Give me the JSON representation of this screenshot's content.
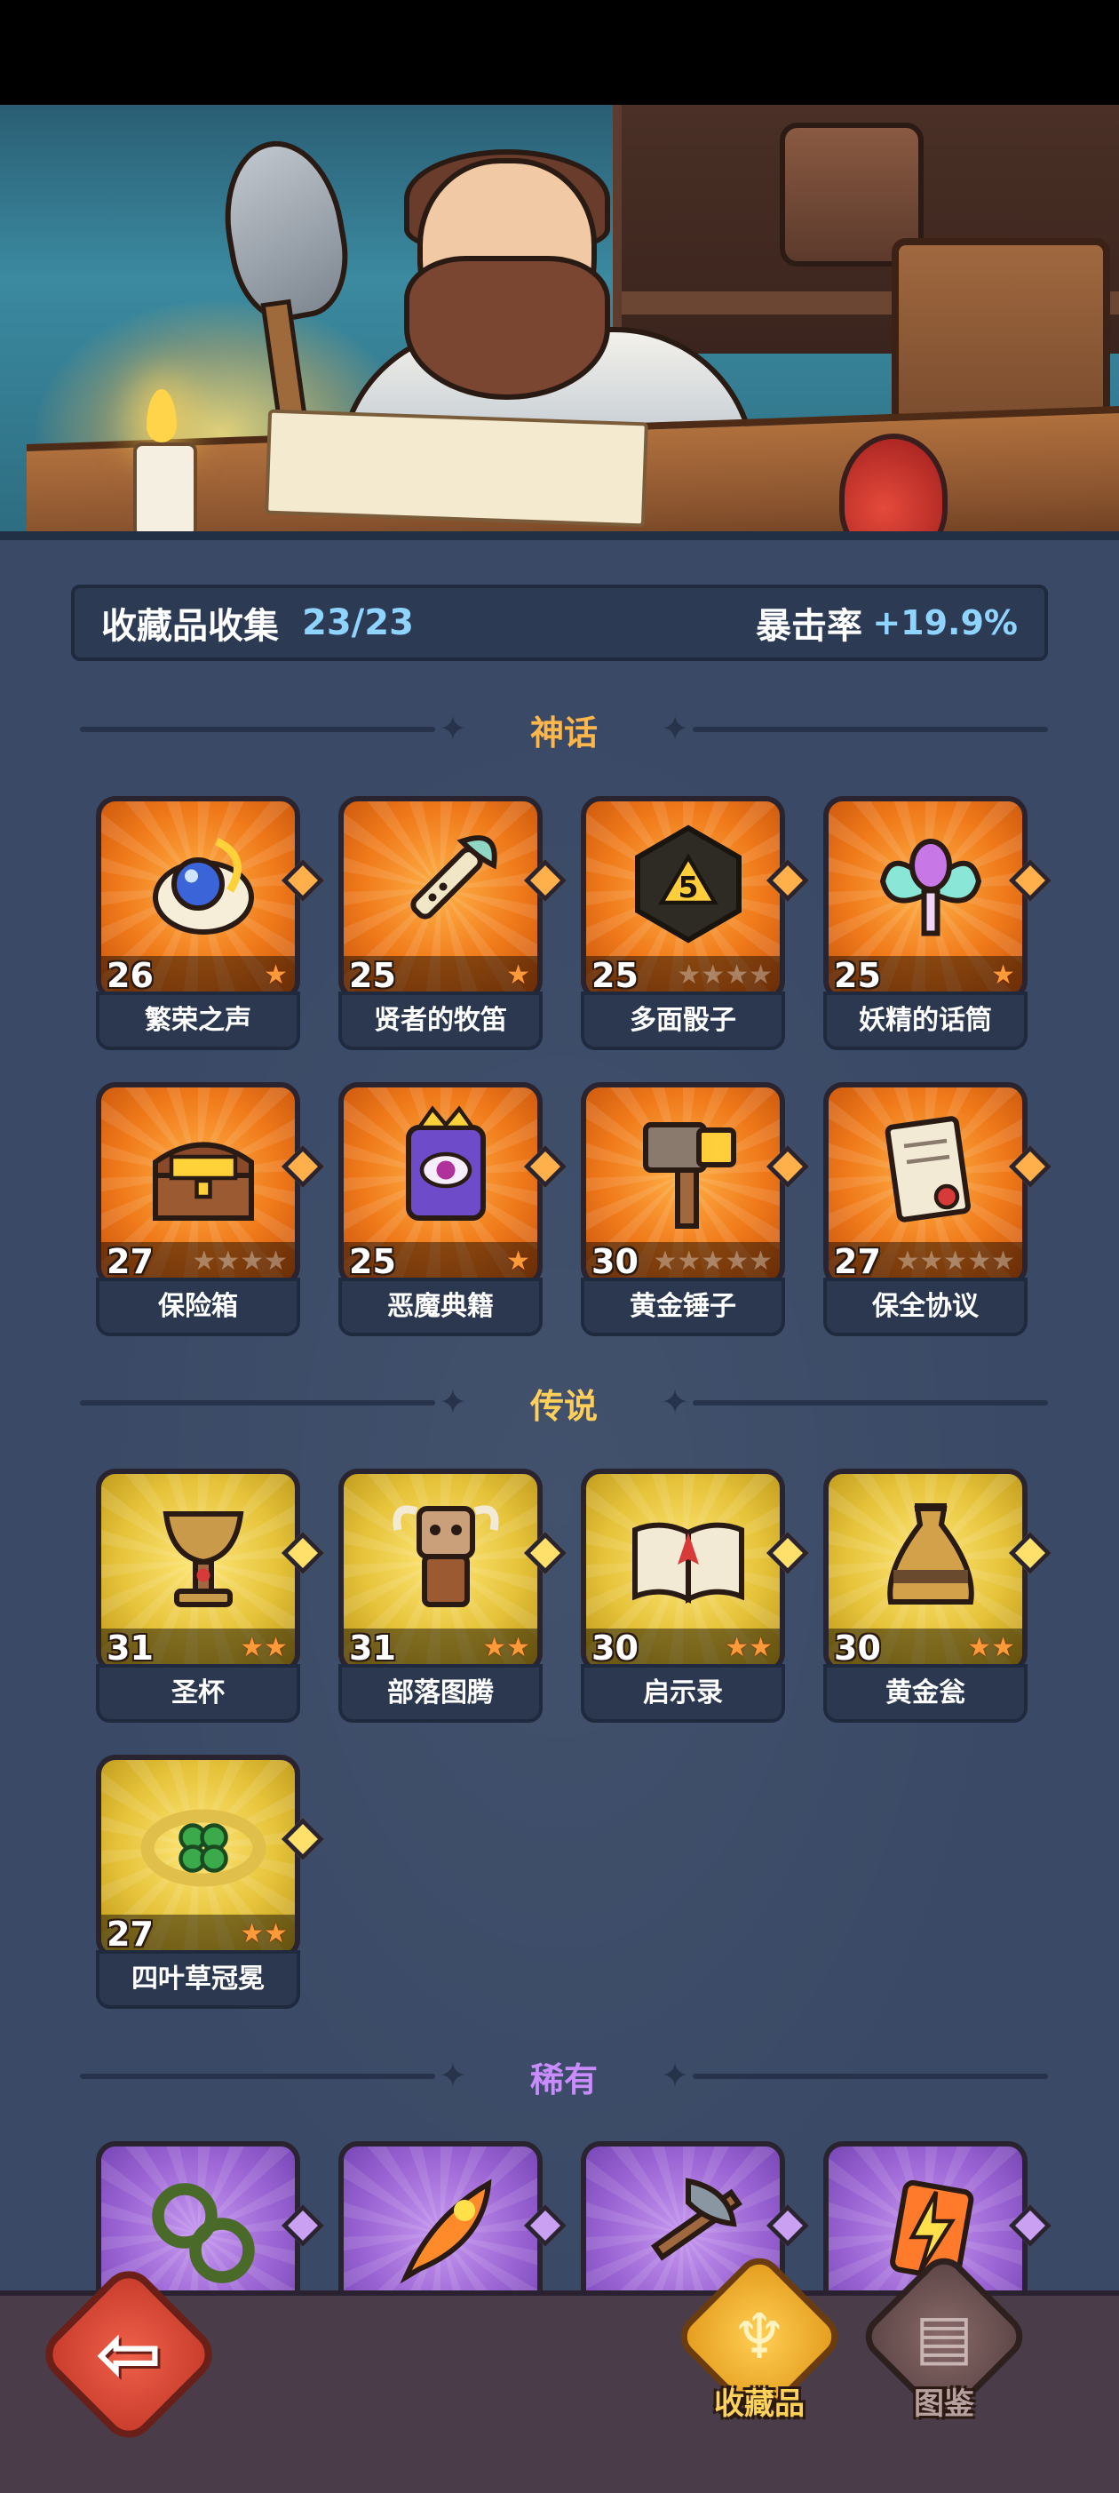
{
  "collection": {
    "label": "收藏品收集",
    "count": "23/23",
    "crit_label": "暴击率",
    "crit_value": "+19.9%"
  },
  "sections": {
    "mythic": {
      "title": "神话",
      "color": "#ffb64a",
      "items": [
        {
          "name": "繁荣之声",
          "level": "26",
          "stars": 1,
          "icon": "shell-orb-icon"
        },
        {
          "name": "贤者的牧笛",
          "level": "25",
          "stars": 1,
          "icon": "flute-icon"
        },
        {
          "name": "多面骰子",
          "level": "25",
          "stars": 4,
          "icon": "d20-dice-icon"
        },
        {
          "name": "妖精的话筒",
          "level": "25",
          "stars": 1,
          "icon": "fairy-microphone-icon"
        },
        {
          "name": "保险箱",
          "level": "27",
          "stars": 4,
          "icon": "treasure-chest-icon"
        },
        {
          "name": "恶魔典籍",
          "level": "25",
          "stars": 1,
          "icon": "demon-tome-icon"
        },
        {
          "name": "黄金锤子",
          "level": "30",
          "stars": 5,
          "icon": "golden-hammer-icon"
        },
        {
          "name": "保全协议",
          "level": "27",
          "stars": 5,
          "icon": "contract-scroll-icon"
        }
      ]
    },
    "legend": {
      "title": "传说",
      "color": "#ffcf5a",
      "items": [
        {
          "name": "圣杯",
          "level": "31",
          "stars": 2,
          "icon": "grail-icon"
        },
        {
          "name": "部落图腾",
          "level": "31",
          "stars": 2,
          "icon": "tribal-totem-icon"
        },
        {
          "name": "启示录",
          "level": "30",
          "stars": 2,
          "icon": "open-book-icon"
        },
        {
          "name": "黄金瓮",
          "level": "30",
          "stars": 2,
          "icon": "golden-urn-icon"
        },
        {
          "name": "四叶草冠冕",
          "level": "27",
          "stars": 2,
          "icon": "clover-crown-icon"
        }
      ]
    },
    "rare": {
      "title": "稀有",
      "color": "#c98cff",
      "items": [
        {
          "icon": "thorn-vine-icon"
        },
        {
          "icon": "phoenix-feather-icon"
        },
        {
          "icon": "battle-axe-icon"
        },
        {
          "icon": "lightning-card-icon"
        }
      ]
    }
  },
  "nav": {
    "collection": "收藏品",
    "guide": "图鉴"
  }
}
